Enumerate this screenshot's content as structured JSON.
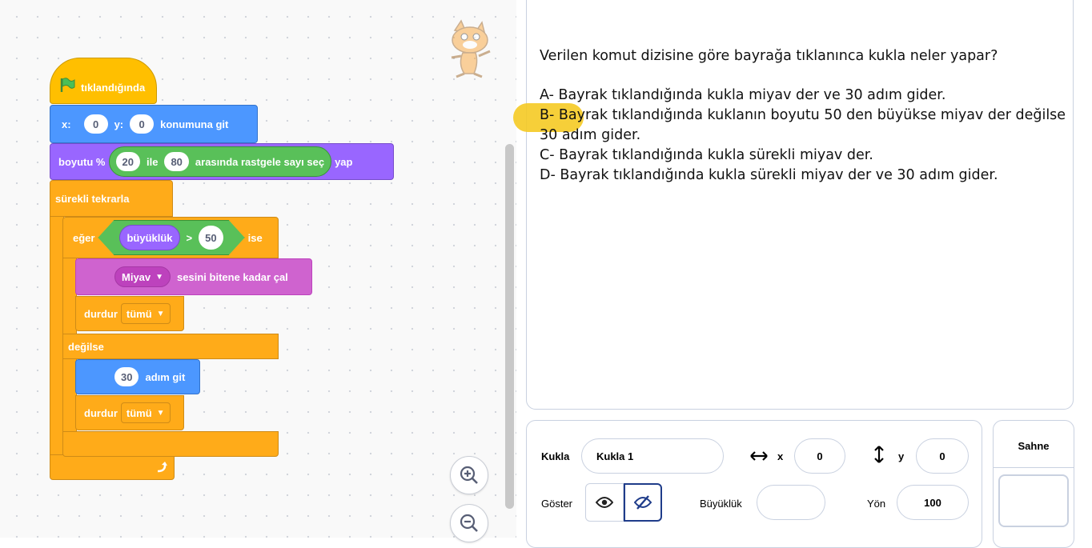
{
  "code": {
    "event": {
      "label": "tıklandığında"
    },
    "goto": {
      "x_label": "x:",
      "x_value": "0",
      "y_label": "y:",
      "y_value": "0",
      "suffix": "konumuna git"
    },
    "setsize": {
      "prefix": "boyutu %",
      "from": "20",
      "ile": "ile",
      "to": "80",
      "rand_text": "arasında rastgele sayı seç",
      "suffix": "yap"
    },
    "forever": {
      "label": "sürekli tekrarla"
    },
    "if": {
      "label": "eğer",
      "reporter": "büyüklük",
      "op": ">",
      "value": "50",
      "then": "ise",
      "else": "değilse"
    },
    "play_sound": {
      "sound": "Miyav",
      "text": "sesini bitene kadar çal"
    },
    "stop1": {
      "label": "durdur",
      "option": "tümü"
    },
    "move": {
      "steps": "30",
      "text": "adım git"
    },
    "stop2": {
      "label": "durdur",
      "option": "tümü"
    }
  },
  "question": {
    "prompt": "Verilen komut dizisine göre bayrağa tıklanınca kukla neler yapar?",
    "options": [
      "A- Bayrak tıklandığında kukla miyav der ve 30 adım gider.",
      "B- Bayrak tıklandığında kuklanın boyutu 50 den büyükse miyav der değilse 30 adım gider.",
      "C- Bayrak tıklandığında kukla sürekli miyav der.",
      "D- Bayrak tıklandığında kukla sürekli miyav der ve 30 adım gider."
    ]
  },
  "sprite_info": {
    "sprite_label": "Kukla",
    "sprite_name": "Kukla 1",
    "x_label": "x",
    "x_value": "0",
    "y_label": "y",
    "y_value": "0",
    "show_label": "Göster",
    "size_label": "Büyüklük",
    "size_value": "",
    "direction_label": "Yön",
    "direction_value": "100"
  },
  "stage": {
    "title": "Sahne"
  },
  "colors": {
    "events": "#ffbf00",
    "motion": "#4c97ff",
    "control": "#ffab19",
    "looks": "#9966ff",
    "sound": "#cf63cf",
    "operators": "#59c059",
    "highlight": "#f5c81e"
  }
}
